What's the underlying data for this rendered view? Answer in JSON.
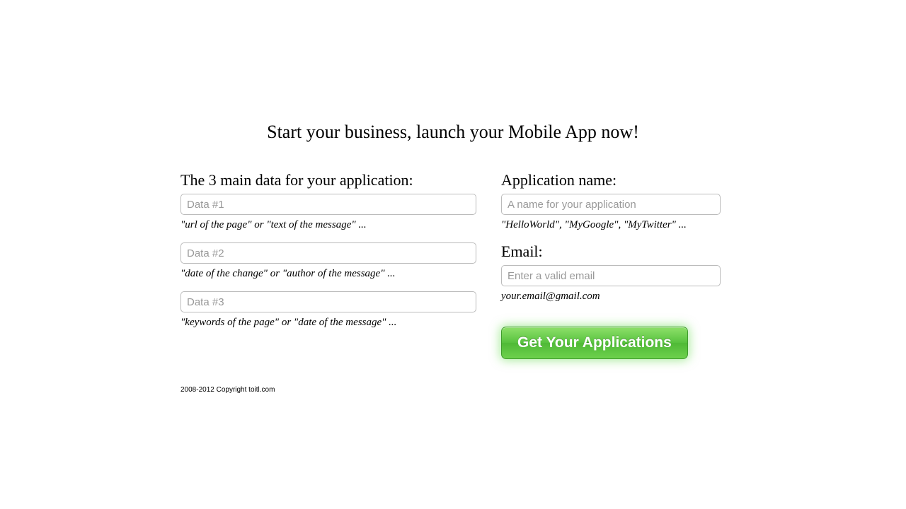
{
  "title": "Start your business, launch your Mobile App now!",
  "left": {
    "heading": "The 3 main data for your application:",
    "fields": [
      {
        "placeholder": "Data #1",
        "hint": "\"url of the page\" or \"text of the message\" ..."
      },
      {
        "placeholder": "Data #2",
        "hint": "\"date of the change\" or \"author of the message\" ..."
      },
      {
        "placeholder": "Data #3",
        "hint": "\"keywords of the page\" or \"date of the message\" ..."
      }
    ]
  },
  "right": {
    "appname": {
      "heading": "Application name:",
      "placeholder": "A name for your application",
      "hint": "\"HelloWorld\", \"MyGoogle\", \"MyTwitter\" ..."
    },
    "email": {
      "heading": "Email:",
      "placeholder": "Enter a valid email",
      "hint": "your.email@gmail.com"
    },
    "cta": "Get Your Applications"
  },
  "footer": "2008-2012 Copyright toitl.com"
}
